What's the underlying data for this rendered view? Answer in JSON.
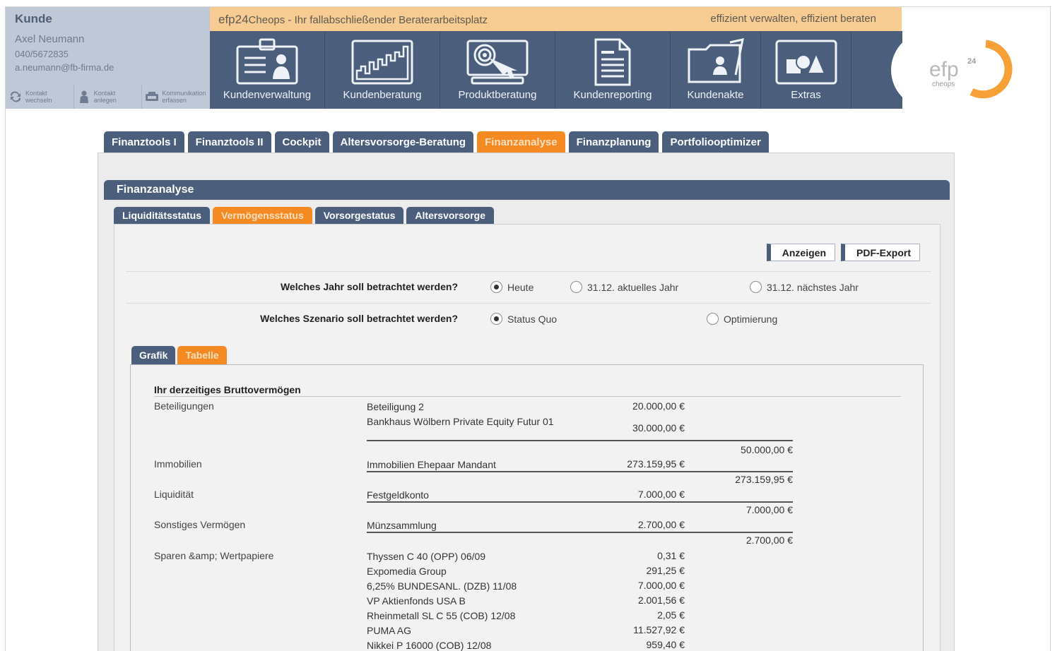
{
  "customer": {
    "label": "Kunde",
    "name": "Axel Neumann",
    "phone": "040/5672835",
    "email": "a.neumann@fb-firma.de",
    "actions": [
      {
        "l1": "Kontakt",
        "l2": "wechseln",
        "icon": "switch-icon"
      },
      {
        "l1": "Kontakt",
        "l2": "anlegen",
        "icon": "person-icon"
      },
      {
        "l1": "Kommunikation",
        "l2": "erfassen",
        "icon": "communication-icon"
      }
    ]
  },
  "topbar": {
    "brand": "efp24",
    "app": "Cheops",
    "tagline": " - Ihr fallabschließender Beraterarbeitsplatz",
    "slogan": "effizient verwalten, effizient beraten"
  },
  "nav": [
    {
      "label": "Kundenverwaltung",
      "icon": "customer-card-icon"
    },
    {
      "label": "Kundenberatung",
      "icon": "chart-icon"
    },
    {
      "label": "Produktberatung",
      "icon": "product-target-icon"
    },
    {
      "label": "Kundenreporting",
      "icon": "report-document-icon"
    },
    {
      "label": "Kundenakte",
      "icon": "customer-folder-icon"
    },
    {
      "label": "Extras",
      "icon": "shapes-icon"
    }
  ],
  "logo": {
    "text": "efp",
    "sup": "24",
    "sub": "cheops"
  },
  "main_tabs": [
    "Finanztools I",
    "Finanztools II",
    "Cockpit",
    "Altersvorsorge-Beratung",
    "Finanzanalyse",
    "Finanzplanung",
    "Portfoliooptimizer"
  ],
  "main_tab_active": 4,
  "panel_title": "Finanzanalyse",
  "sub_tabs": [
    "Liquiditätsstatus",
    "Vermögensstatus",
    "Vorsorgestatus",
    "Altersvorsorge"
  ],
  "sub_tab_active": 1,
  "buttons": {
    "show": "Anzeigen",
    "pdf": "PDF-Export"
  },
  "question_year": {
    "text": "Welches Jahr soll betrachtet werden?",
    "options": [
      "Heute",
      "31.12. aktuelles Jahr",
      "31.12. nächstes Jahr"
    ],
    "selected": 0
  },
  "question_scenario": {
    "text": "Welches Szenario soll betrachtet werden?",
    "options": [
      "Status Quo",
      "Optimierung"
    ],
    "selected": 0
  },
  "view_tabs": [
    "Grafik",
    "Tabelle"
  ],
  "view_tab_active": 1,
  "table": {
    "title": "Ihr derzeitiges Bruttovermögen",
    "groups": [
      {
        "category": "Beteiligungen",
        "items": [
          {
            "name": "Beteiligung 2",
            "amount": "20.000,00 €"
          },
          {
            "name": "Bankhaus Wölbern Private Equity Futur 01",
            "amount": "30.000,00 €"
          }
        ],
        "total": "50.000,00 €"
      },
      {
        "category": "Immobilien",
        "items": [
          {
            "name": "Immobilien Ehepaar Mandant",
            "amount": "273.159,95 €"
          }
        ],
        "total": "273.159,95 €"
      },
      {
        "category": "Liquidität",
        "items": [
          {
            "name": "Festgeldkonto",
            "amount": "7.000,00 €"
          }
        ],
        "total": "7.000,00 €"
      },
      {
        "category": "Sonstiges Vermögen",
        "items": [
          {
            "name": "Münzsammlung",
            "amount": "2.700,00 €"
          }
        ],
        "total": "2.700,00 €"
      },
      {
        "category": "Sparen &amp; Wertpapiere",
        "items": [
          {
            "name": "Thyssen C 40 (OPP) 06/09",
            "amount": "0,31 €"
          },
          {
            "name": "Expomedia Group",
            "amount": "291,25 €"
          },
          {
            "name": "6,25% BUNDESANL. (DZB) 11/08",
            "amount": "7.000,00 €"
          },
          {
            "name": "VP Aktienfonds USA B",
            "amount": "2.001,56 €"
          },
          {
            "name": "Rheinmetall SL C 55 (COB) 12/08",
            "amount": "2,05 €"
          },
          {
            "name": "PUMA AG",
            "amount": "11.527,92 €"
          },
          {
            "name": "Nikkei P 16000 (COB) 12/08",
            "amount": "959,40 €"
          }
        ]
      }
    ]
  }
}
